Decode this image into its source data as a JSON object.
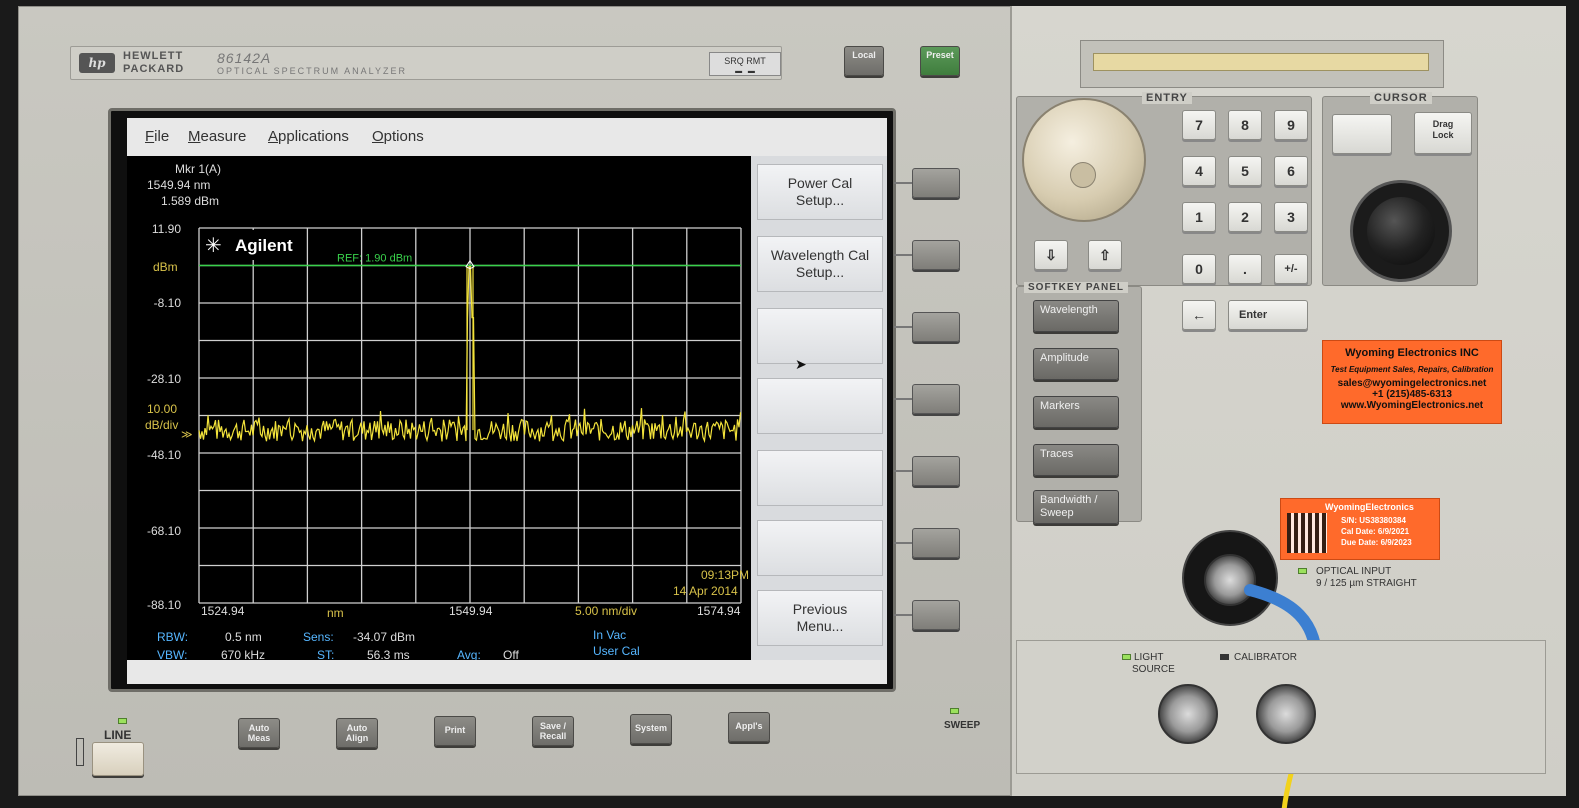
{
  "instrument": {
    "brand_line1": "HEWLETT",
    "brand_line2": "PACKARD",
    "model": "86142A",
    "subtitle": "OPTICAL SPECTRUM ANALYZER",
    "sro_rmt": "SRQ RMT",
    "local": "Local",
    "preset": "Preset",
    "hp_logo": "hp"
  },
  "menu": {
    "file": "File",
    "measure": "Measure",
    "applications": "Applications",
    "options": "Options"
  },
  "marker": {
    "line1": "Mkr 1(A)",
    "line2": "1549.94 nm",
    "line3": "1.589 dBm"
  },
  "plot": {
    "agilent": "Agilent",
    "ref_label": "REF: 1.90 dBm",
    "y_top": "11.90",
    "y_unit": "dBm",
    "y_ticks": [
      "-8.10",
      "-28.10",
      "-48.10",
      "-68.10",
      "-88.10"
    ],
    "scale_value": "10.00",
    "scale_unit": "dB/div",
    "x_start": "1524.94",
    "x_unit": "nm",
    "x_center": "1549.94",
    "x_div": "5.00 nm/div",
    "x_stop": "1574.94",
    "time": "09:13PM",
    "date": "14 Apr 2014"
  },
  "status": {
    "rbw_label": "RBW:",
    "rbw_value": "0.5 nm",
    "sens_label": "Sens:",
    "sens_value": "-34.07 dBm",
    "vbw_label": "VBW:",
    "vbw_value": "670 kHz",
    "st_label": "ST:",
    "st_value": "56.3 ms",
    "avg_label": "Avg:",
    "avg_value": "Off",
    "in_vac": "In Vac",
    "user_cal": "User Cal"
  },
  "softkeys": {
    "k1_l1": "Power Cal",
    "k1_l2": "Setup...",
    "k2_l1": "Wavelength Cal",
    "k2_l2": "Setup...",
    "k7_l1": "Previous",
    "k7_l2": "Menu..."
  },
  "front_buttons": {
    "line": "LINE",
    "auto_meas_1": "Auto",
    "auto_meas_2": "Meas",
    "auto_align_1": "Auto",
    "auto_align_2": "Align",
    "print": "Print",
    "save_recall_1": "Save /",
    "save_recall_2": "Recall",
    "system": "System",
    "appls": "Appl's",
    "sweep": "SWEEP"
  },
  "entry": {
    "label": "ENTRY",
    "keys": [
      "7",
      "8",
      "9",
      "4",
      "5",
      "6",
      "1",
      "2",
      "3",
      "0",
      ".",
      "+/-"
    ],
    "backspace": "←",
    "enter": "Enter",
    "down": "⇩",
    "up": "⇧"
  },
  "cursor": {
    "label": "CURSOR",
    "drag_lock_1": "Drag",
    "drag_lock_2": "Lock"
  },
  "softkey_panel": {
    "label": "SOFTKEY PANEL",
    "buttons": [
      "Wavelength",
      "Amplitude",
      "Markers",
      "Traces"
    ],
    "bw_1": "Bandwidth /",
    "bw_2": "Sweep"
  },
  "sticker1": {
    "name": "Wyoming Electronics INC",
    "tag": "Test Equipment Sales, Repairs, Calibration",
    "email": "sales@wyomingelectronics.net",
    "phone": "+1 (215)485-6313",
    "web": "www.WyomingElectronics.net"
  },
  "sticker2": {
    "name": "WyomingElectronics",
    "sn": "S/N: US38380384",
    "cal": "Cal Date: 6/9/2021",
    "due": "Due Date: 6/9/2023"
  },
  "connectors": {
    "optical_input_1": "OPTICAL INPUT",
    "optical_input_2": "9 / 125 µm  STRAIGHT",
    "light_source_1": "LIGHT",
    "light_source_2": "SOURCE",
    "calibrator": "CALIBRATOR"
  },
  "chart_data": {
    "type": "line",
    "title": "",
    "xlabel": "nm",
    "ylabel": "dBm",
    "xlim": [
      1524.94,
      1574.94
    ],
    "ylim": [
      -88.1,
      11.9
    ],
    "reference_level": 1.9,
    "noise_floor": -42,
    "peak": {
      "x": 1549.94,
      "y": 1.589
    },
    "grid": true
  },
  "colors": {
    "trace": "#f3e33b",
    "ref_line": "#39d14b",
    "grid": "#cfcfcf",
    "label_yellow": "#d8c24a",
    "label_cyan": "#56b6ff",
    "sticker": "#ff6a2b"
  }
}
